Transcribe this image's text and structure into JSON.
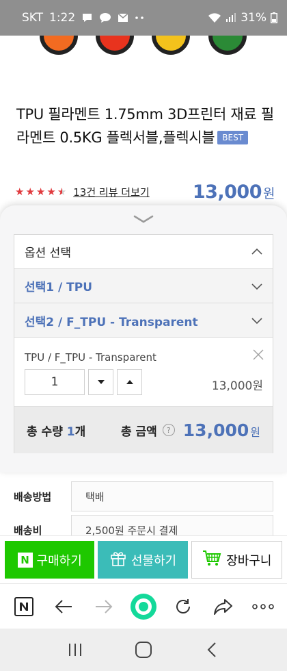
{
  "status_bar": {
    "carrier": "SKT",
    "time": "1:22",
    "battery": "31%",
    "icons": [
      "chat-icon",
      "talk-icon",
      "mail-icon",
      "more-dots-icon",
      "wifi-icon",
      "signal-icon",
      "battery-icon"
    ]
  },
  "product": {
    "title": "TPU 필라멘트 1.75mm 3D프린터 재료 필라멘트 0.5KG 플렉서블,플렉시블",
    "badge": "BEST",
    "rating": 4.5,
    "review_link": "13건 리뷰 더보기",
    "price": "13,000",
    "price_unit": "원",
    "spool_colors": [
      "#f26b21",
      "#e8331e",
      "#f3c21c",
      "#2b8a36"
    ]
  },
  "options": {
    "header": "옵션 선택",
    "select1": "선택1 / TPU",
    "select2": "선택2 / F_TPU - Transparent"
  },
  "selected": {
    "name": "TPU / F_TPU - Transparent",
    "quantity": "1",
    "price": "13,000원"
  },
  "totals": {
    "qty_prefix": "총 수량 ",
    "qty_value": "1",
    "qty_suffix": "개",
    "amount_label": "총 금액",
    "help": "?",
    "amount": "13,000",
    "amount_unit": "원"
  },
  "shipping": {
    "method_label": "배송방법",
    "method_value": "택배",
    "fee_label": "배송비",
    "fee_value": "2,500원 주문시 결제"
  },
  "actions": {
    "buy": "구매하기",
    "buy_logo": "N",
    "gift": "선물하기",
    "cart": "장바구니"
  },
  "colors": {
    "accent_blue": "#4d72b8",
    "naver_green": "#1ec800",
    "gift_teal": "#3bbcb8",
    "star_red": "#e03a3e",
    "badge_blue": "#6a8bd0"
  }
}
